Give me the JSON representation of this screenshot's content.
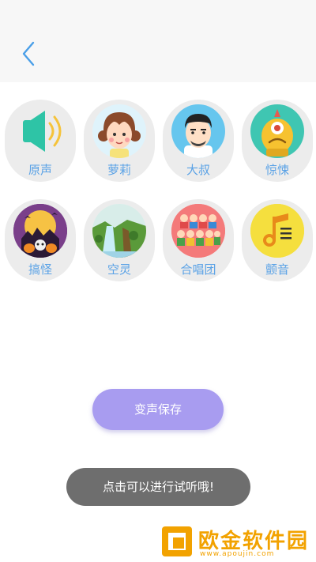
{
  "header": {
    "back_icon": "chevron-left-icon",
    "accent": "#4a9fe8"
  },
  "effects": [
    {
      "id": "original",
      "label": "原声",
      "icon": "speaker-icon"
    },
    {
      "id": "loli",
      "label": "萝莉",
      "icon": "girl-icon"
    },
    {
      "id": "uncle",
      "label": "大叔",
      "icon": "man-icon"
    },
    {
      "id": "horror",
      "label": "惊悚",
      "icon": "monster-icon"
    },
    {
      "id": "funny",
      "label": "搞怪",
      "icon": "halloween-icon"
    },
    {
      "id": "ethereal",
      "label": "空灵",
      "icon": "waterfall-icon"
    },
    {
      "id": "chorus",
      "label": "合唱团",
      "icon": "choir-icon"
    },
    {
      "id": "tremolo",
      "label": "颤音",
      "icon": "music-note-icon"
    }
  ],
  "save_button": {
    "label": "变声保存",
    "color": "#a89cf0"
  },
  "toast": {
    "text": "点击可以进行试听哦!"
  },
  "watermark": {
    "name": "欧金软件园",
    "url": "www.apoujin.com",
    "color": "#f2a200"
  }
}
